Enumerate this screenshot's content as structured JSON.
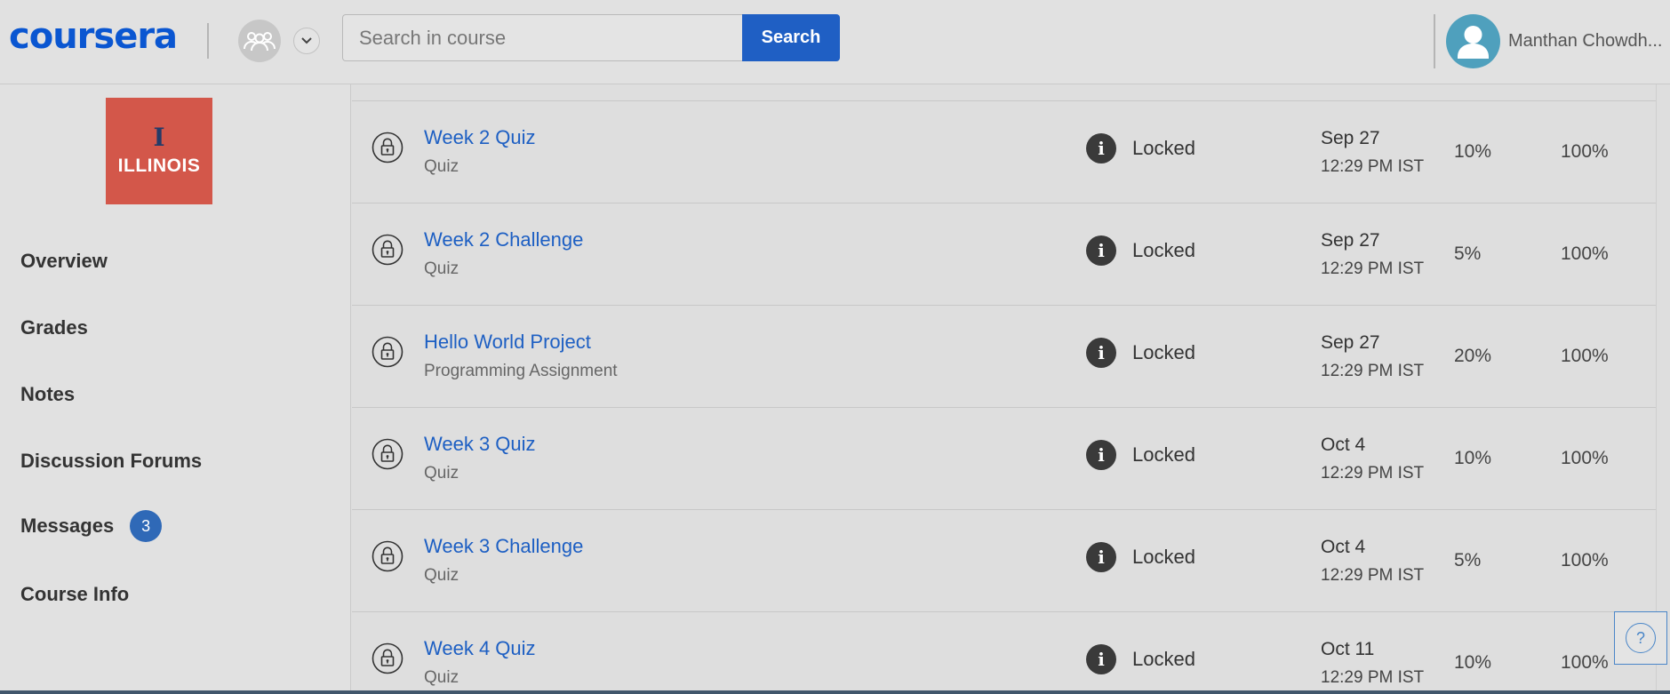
{
  "header": {
    "logo": "coursera",
    "search": {
      "placeholder": "Search in course",
      "value": "",
      "button_label": "Search"
    },
    "user_name": "Manthan Chowdh..."
  },
  "sidebar": {
    "course_logo": {
      "mark": "I",
      "word": "ILLINOIS"
    },
    "items": [
      {
        "label": "Overview"
      },
      {
        "label": "Grades"
      },
      {
        "label": "Notes"
      },
      {
        "label": "Discussion Forums"
      },
      {
        "label": "Messages",
        "badge": "3"
      },
      {
        "label": "Course Info"
      }
    ]
  },
  "assignments": [
    {
      "title": "Week 2 Quiz",
      "type": "Quiz",
      "status": "Locked",
      "due_date": "Sep 27",
      "due_time": "12:29 PM IST",
      "weight": "10%",
      "grade": "100%"
    },
    {
      "title": "Week 2 Challenge",
      "type": "Quiz",
      "status": "Locked",
      "due_date": "Sep 27",
      "due_time": "12:29 PM IST",
      "weight": "5%",
      "grade": "100%"
    },
    {
      "title": "Hello World Project",
      "type": "Programming Assignment",
      "status": "Locked",
      "due_date": "Sep 27",
      "due_time": "12:29 PM IST",
      "weight": "20%",
      "grade": "100%"
    },
    {
      "title": "Week 3 Quiz",
      "type": "Quiz",
      "status": "Locked",
      "due_date": "Oct 4",
      "due_time": "12:29 PM IST",
      "weight": "10%",
      "grade": "100%"
    },
    {
      "title": "Week 3 Challenge",
      "type": "Quiz",
      "status": "Locked",
      "due_date": "Oct 4",
      "due_time": "12:29 PM IST",
      "weight": "5%",
      "grade": "100%"
    },
    {
      "title": "Week 4 Quiz",
      "type": "Quiz",
      "status": "Locked",
      "due_date": "Oct 11",
      "due_time": "12:29 PM IST",
      "weight": "10%",
      "grade": "100%"
    }
  ],
  "icons": {
    "lock": "lock-icon",
    "info": "info-icon",
    "help": "help-icon",
    "group": "group-icon",
    "chevron": "chevron-down-icon",
    "avatar": "user-avatar-icon"
  },
  "colors": {
    "brand": "#0a56d1",
    "link": "#1d5fc3",
    "search_button": "#1f5fc4",
    "badge": "#2f69b7",
    "avatar": "#4fa0bd",
    "course_logo": "#d3574a"
  },
  "help_glyph": "?"
}
